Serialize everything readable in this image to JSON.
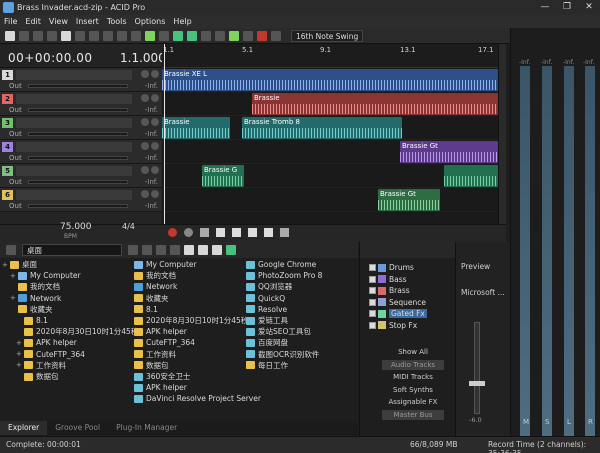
{
  "window": {
    "title": "Brass Invader.acd-zip - ACID Pro",
    "controls": [
      "—",
      "❐",
      "✕"
    ]
  },
  "menu": [
    "File",
    "Edit",
    "View",
    "Insert",
    "Tools",
    "Options",
    "Help"
  ],
  "toolbar": {
    "snap_label": "16th Note Swing"
  },
  "time": {
    "timecode": "00+00:00.00",
    "measure": "1.1.000"
  },
  "tracks": [
    {
      "num": "1",
      "color": "#d9d9d9",
      "out": "Out",
      "db": "-Inf."
    },
    {
      "num": "2",
      "color": "#e06666",
      "out": "Out",
      "db": "-Inf."
    },
    {
      "num": "3",
      "color": "#6fc06f",
      "out": "Out",
      "db": "-Inf."
    },
    {
      "num": "4",
      "color": "#a080e0",
      "out": "Out",
      "db": "-Inf."
    },
    {
      "num": "5",
      "color": "#7fbf7f",
      "out": "Out",
      "db": "-Inf."
    },
    {
      "num": "6",
      "color": "#e0c060",
      "out": "Out",
      "db": "-Inf."
    }
  ],
  "ruler": {
    "markers": [
      "1.1",
      "5.1",
      "9.1",
      "13.1",
      "17.1"
    ]
  },
  "clips": [
    {
      "lane": 0,
      "label": "Brassie XE L",
      "color": "#3f68b0"
    },
    {
      "lane": 1,
      "label": "Brassie",
      "color": "#b04848"
    },
    {
      "lane": 2,
      "label": "Brassie",
      "color": "#2f8888"
    },
    {
      "lane": 2,
      "label": "Brassie Tromb 8",
      "color": "#2f8888"
    },
    {
      "lane": 3,
      "label": "Brassie Gt",
      "color": "#7b4fb0"
    },
    {
      "lane": 4,
      "label": "Brassie G",
      "color": "#2f8f6a"
    },
    {
      "lane": 5,
      "label": "Brassie Gt",
      "color": "#3e8f5a"
    }
  ],
  "transport": {
    "tempo": "75.000",
    "tempo_label": "BPM",
    "timesig_top": "4",
    "timesig_bottom": "4"
  },
  "explorer": {
    "path": "桌面",
    "tree": [
      {
        "label": "桌面",
        "icon": "folder",
        "expanded": true
      },
      {
        "label": "My Computer",
        "icon": "pc"
      },
      {
        "label": "我的文档",
        "icon": "folder"
      },
      {
        "label": "Network",
        "icon": "net"
      },
      {
        "label": "收藏夹",
        "icon": "folder"
      },
      {
        "label": "8.1",
        "icon": "folder"
      },
      {
        "label": "2020年8月30日10时1分45秒",
        "icon": "folder"
      },
      {
        "label": "APK helper",
        "icon": "folder"
      },
      {
        "label": "CuteFTP_364",
        "icon": "folder"
      },
      {
        "label": "工作资料",
        "icon": "folder"
      },
      {
        "label": "数据包",
        "icon": "folder"
      }
    ],
    "files_col1": [
      "My Computer",
      "我的文档",
      "Network",
      "收藏夹",
      "8.1",
      "2020年8月30日10时1分45秒",
      "APK helper",
      "CuteFTP_364",
      "工作资料",
      "数据包",
      "360安全卫士",
      "APK helper",
      "DaVinci Resolve Project Server"
    ],
    "files_col2": [
      "Google Chrome",
      "PhotoZoom Pro 8",
      "QQ浏览器",
      "QuickQ",
      "Resolve",
      "爱链工具",
      "爱站SEO工具包",
      "百度网盘",
      "截图OCR识别软件",
      "每日工作"
    ],
    "tabs": [
      "Explorer",
      "Groove Pool",
      "Plug-In Manager"
    ]
  },
  "plugins": {
    "fx_list": [
      {
        "label": "Drums",
        "color": "#6a9ad8"
      },
      {
        "label": "Bass",
        "color": "#8f6ad8"
      },
      {
        "label": "Brass",
        "color": "#d86a6a"
      },
      {
        "label": "Sequence",
        "color": "#8fa0d8"
      },
      {
        "label": "Gated Fx",
        "color": "#6ad8a0"
      },
      {
        "label": "Stop Fx",
        "color": "#d8c06a"
      }
    ],
    "buttons": [
      "Show All",
      "Audio Tracks",
      "MIDI Tracks",
      "Soft Synths",
      "Assignable FX",
      "Master Bus"
    ]
  },
  "preview": {
    "label": "Preview",
    "device": "Microsoft ...",
    "fader_db": "-6.0"
  },
  "meters": {
    "top_db": [
      "-Inf.",
      "-Inf.",
      "-Inf.",
      "-Inf."
    ],
    "labels": [
      "M",
      "S",
      "L",
      "R"
    ]
  },
  "status": {
    "complete": "Complete: 00:00:01",
    "memory": "66/8,089 MB",
    "record": "Record Time (2 channels): 35:36:35"
  }
}
